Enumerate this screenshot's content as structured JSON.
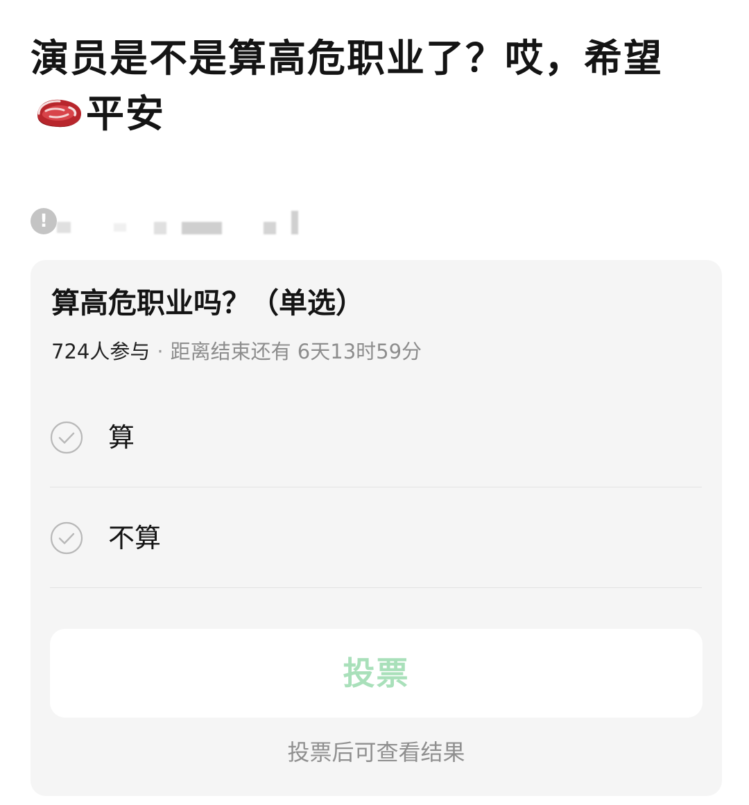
{
  "post": {
    "title_part1": "演员是不是算高危职业了？哎，希望",
    "title_part2": "平安",
    "emoji_icon": "steak-icon"
  },
  "notice": {
    "icon": "exclamation-icon"
  },
  "poll": {
    "question": "算高危职业吗？（单选）",
    "participants": "724人参与",
    "separator": "·",
    "deadline": "距离结束还有 6天13时59分",
    "options": [
      {
        "label": "算"
      },
      {
        "label": "不算"
      }
    ],
    "vote_button": "投票",
    "hint": "投票后可查看结果",
    "accent_color": "#a9e0ba"
  }
}
